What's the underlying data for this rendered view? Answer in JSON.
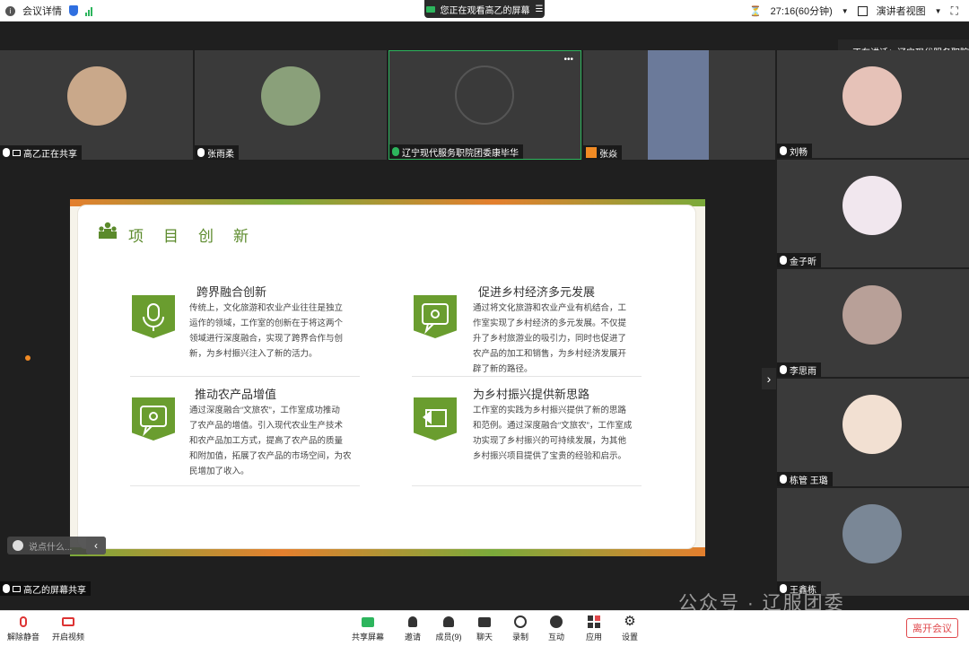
{
  "topbar": {
    "meeting_info": "会议详情",
    "share_banner": "您正在观看高乙的屏幕",
    "timer": "27:16(60分钟)",
    "view_mode": "演讲者视图"
  },
  "speaking": "正在讲话：辽宁现代服务职院",
  "participants_top": [
    {
      "name": "高乙正在共享",
      "avatar_color": "#c9a88a"
    },
    {
      "name": "张雨柔",
      "avatar_color": "#8aa07a"
    },
    {
      "name": "辽宁现代服务职院团委康毕华",
      "avatar_color": "#3a3a3a"
    },
    {
      "name": "张焱",
      "avatar_color": "#6b7a9a"
    }
  ],
  "participants_side": [
    {
      "name": "刘畅",
      "avatar_color": "#e6c2b8"
    },
    {
      "name": "金子昕",
      "avatar_color": "#f1e7ee"
    },
    {
      "name": "李思雨",
      "avatar_color": "#b8a098"
    },
    {
      "name": "栋管 王璐",
      "avatar_color": "#f2e0d2"
    },
    {
      "name": "王鑫栋",
      "avatar_color": "#7a8796"
    }
  ],
  "slide": {
    "title": "项目创新",
    "features": [
      {
        "title": "跨界融合创新",
        "text": [
          "传统上，文化旅游和农业产业往往是独立",
          "运作的领域，工作室的创新在于将这两个",
          "领域进行深度融合，实现了跨界合作与创",
          "新，为乡村振兴注入了新的活力。"
        ]
      },
      {
        "title": "促进乡村经济多元发展",
        "text": [
          "通过将文化旅游和农业产业有机结合，工",
          "作室实现了乡村经济的多元发展。不仅提",
          "升了乡村旅游业的吸引力，同时也促进了",
          "农产品的加工和销售，为乡村经济发展开",
          "辟了新的路径。"
        ]
      },
      {
        "title": "推动农产品增值",
        "text": [
          "通过深度融合“文旅农”，工作室成功推动",
          "了农产品的增值。引入现代农业生产技术",
          "和农产品加工方式，提高了农产品的质量",
          "和附加值，拓展了农产品的市场空间，为农",
          "民增加了收入。"
        ]
      },
      {
        "title": "为乡村振兴提供新思路",
        "text": [
          "工作室的实践为乡村振兴提供了新的思路",
          "和范例。通过深度融合“文旅农”，工作室成",
          "功实现了乡村振兴的可持续发展，为其他",
          "乡村振兴项目提供了宝贵的经验和启示。"
        ]
      }
    ]
  },
  "chat": {
    "placeholder": "说点什么..."
  },
  "share_tag": "高乙的屏幕共享",
  "toolbar": {
    "unmute": "解除静音",
    "video": "开启视频",
    "share": "共享屏幕",
    "invite": "邀请",
    "members": "成员(9)",
    "chat": "聊天",
    "record": "录制",
    "interact": "互动",
    "apps": "应用",
    "settings": "设置",
    "leave": "离开会议"
  },
  "watermark": "公众号 · 辽服团委"
}
